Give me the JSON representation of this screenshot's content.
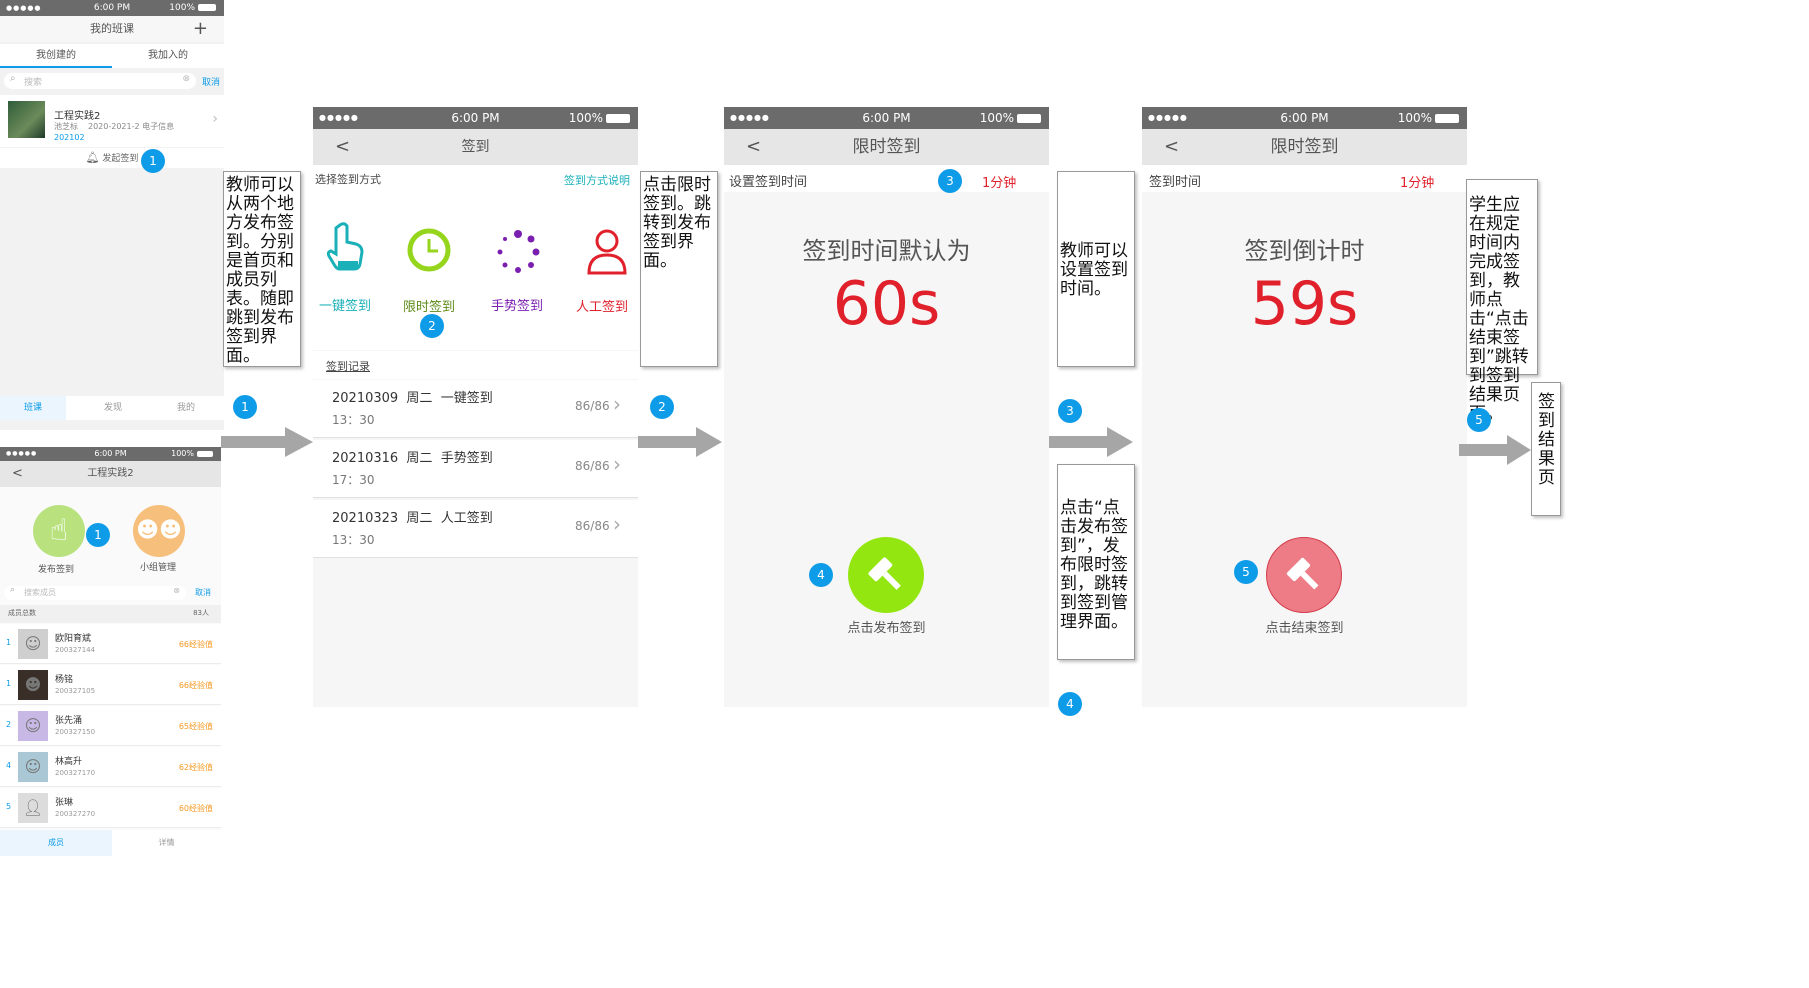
{
  "status_bar": {
    "dots": "●●●●●",
    "time": "6:00 PM",
    "battery": "100%"
  },
  "screen1": {
    "title": "我的班课",
    "plus": "+",
    "tabs": [
      "我创建的",
      "我加入的"
    ],
    "search_placeholder": "搜索",
    "cancel": "取消",
    "class": {
      "name": "工程实践2",
      "teacher": "池芝标",
      "term": "2020-2021-2 电子信息",
      "code": "202102"
    },
    "signin_link": "发起签到",
    "bottom_tabs": [
      "班课",
      "发现",
      "我的"
    ]
  },
  "screen1b": {
    "title": "工程实践2",
    "back": "<",
    "action_publish": "发布签到",
    "action_group": "小组管理",
    "search_placeholder": "搜索成员",
    "cancel": "取消",
    "member_total_label": "成员总数",
    "member_total": "83人",
    "members": [
      {
        "rank": "1",
        "name": "欧阳育斌",
        "id": "200327144",
        "exp": "66经验值"
      },
      {
        "rank": "1",
        "name": "杨铭",
        "id": "200327105",
        "exp": "66经验值"
      },
      {
        "rank": "2",
        "name": "张先涌",
        "id": "200327150",
        "exp": "65经验值"
      },
      {
        "rank": "4",
        "name": "林高升",
        "id": "200327170",
        "exp": "62经验值"
      },
      {
        "rank": "5",
        "name": "张琳",
        "id": "200327270",
        "exp": "60经验值"
      }
    ],
    "bottom_tabs": [
      "成员",
      "详情"
    ]
  },
  "screen2": {
    "title": "签到",
    "back": "<",
    "choose_label": "选择签到方式",
    "explain_link": "签到方式说明",
    "methods": [
      {
        "label": "一键签到",
        "color": "#1ab0b8"
      },
      {
        "label": "限时签到",
        "color": "#5e8b19"
      },
      {
        "label": "手势签到",
        "color": "#7a1fb0"
      },
      {
        "label": "人工签到",
        "color": "#e0212c"
      }
    ],
    "records_label": "签到记录",
    "records": [
      {
        "date": "20210309  周二  一键签到",
        "time": "13：30",
        "count": "86/86"
      },
      {
        "date": "20210316  周二  手势签到",
        "time": "17：30",
        "count": "86/86"
      },
      {
        "date": "20210323  周二  人工签到",
        "time": "13：30",
        "count": "86/86"
      }
    ]
  },
  "screen3": {
    "title": "限时签到",
    "back": "<",
    "setting_label": "设置签到时间",
    "duration": "1分钟",
    "headline": "签到时间默认为",
    "seconds": "60s",
    "button_label": "点击发布签到",
    "button_color": "#93e60f"
  },
  "screen4": {
    "title": "限时签到",
    "back": "<",
    "setting_label": "签到时间",
    "duration": "1分钟",
    "headline": "签到倒计时",
    "seconds": "59s",
    "button_label": "点击结束签到",
    "button_color": "#ee7c86"
  },
  "notes": {
    "n1": "教师可以从两个地方发布签到。分别是首页和成员列表。随即跳到发布签到界面。",
    "n2": "点击限时签到。跳转到发布签到界面。",
    "n3": "教师可以设置签到时间。",
    "n4": "点击“点击发布签到”，发布限时签到，跳转到签到管理界面。",
    "n5": "学生应在规定时间内完成签到，教师点击“点击结束签到”跳转到签到结果页面。",
    "n6": "签到结果页"
  },
  "step_numbers": [
    "1",
    "1",
    "1",
    "2",
    "2",
    "3",
    "3",
    "4",
    "4",
    "5",
    "5"
  ],
  "colors": {
    "accent_blue": "#0e9ce8",
    "red": "#e0212c",
    "gray_bar": "#6b6b6b"
  }
}
